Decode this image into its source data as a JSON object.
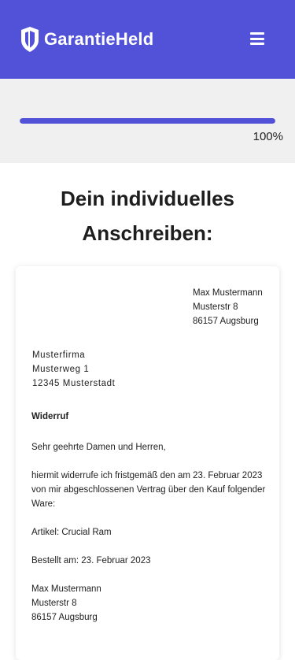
{
  "header": {
    "brand": "GarantieHeld",
    "icons": {
      "logo": "shield-icon",
      "menu": "hamburger-menu-icon"
    },
    "colors": {
      "background": "#5252d9",
      "foreground": "#ffffff"
    }
  },
  "progress": {
    "value": 1.0,
    "label": "100%",
    "colors": {
      "fill": "#5252d9",
      "track": "#d9d9d9"
    }
  },
  "main": {
    "title_line1": "Dein individuelles",
    "title_line2": "Anschreiben:"
  },
  "letter": {
    "sender": [
      "Max Mustermann",
      "Musterstr 8",
      "86157 Augsburg"
    ],
    "recipient": [
      "Musterfirma",
      "Musterweg 1",
      "12345 Musterstadt"
    ],
    "subject": "Widerruf",
    "greeting": "Sehr geehrte Damen und Herren,",
    "body": [
      "hiermit widerrufe ich fristgemäß den am 23. Februar 2023",
      "von mir abgeschlossenen Vertrag über den Kauf folgender",
      "Ware:"
    ],
    "article": "Artikel: Crucial Ram",
    "ordered": "Bestellt am: 23. Februar 2023",
    "signature": [
      "Max Mustermann",
      "Musterstr 8",
      "86157 Augsburg"
    ]
  }
}
